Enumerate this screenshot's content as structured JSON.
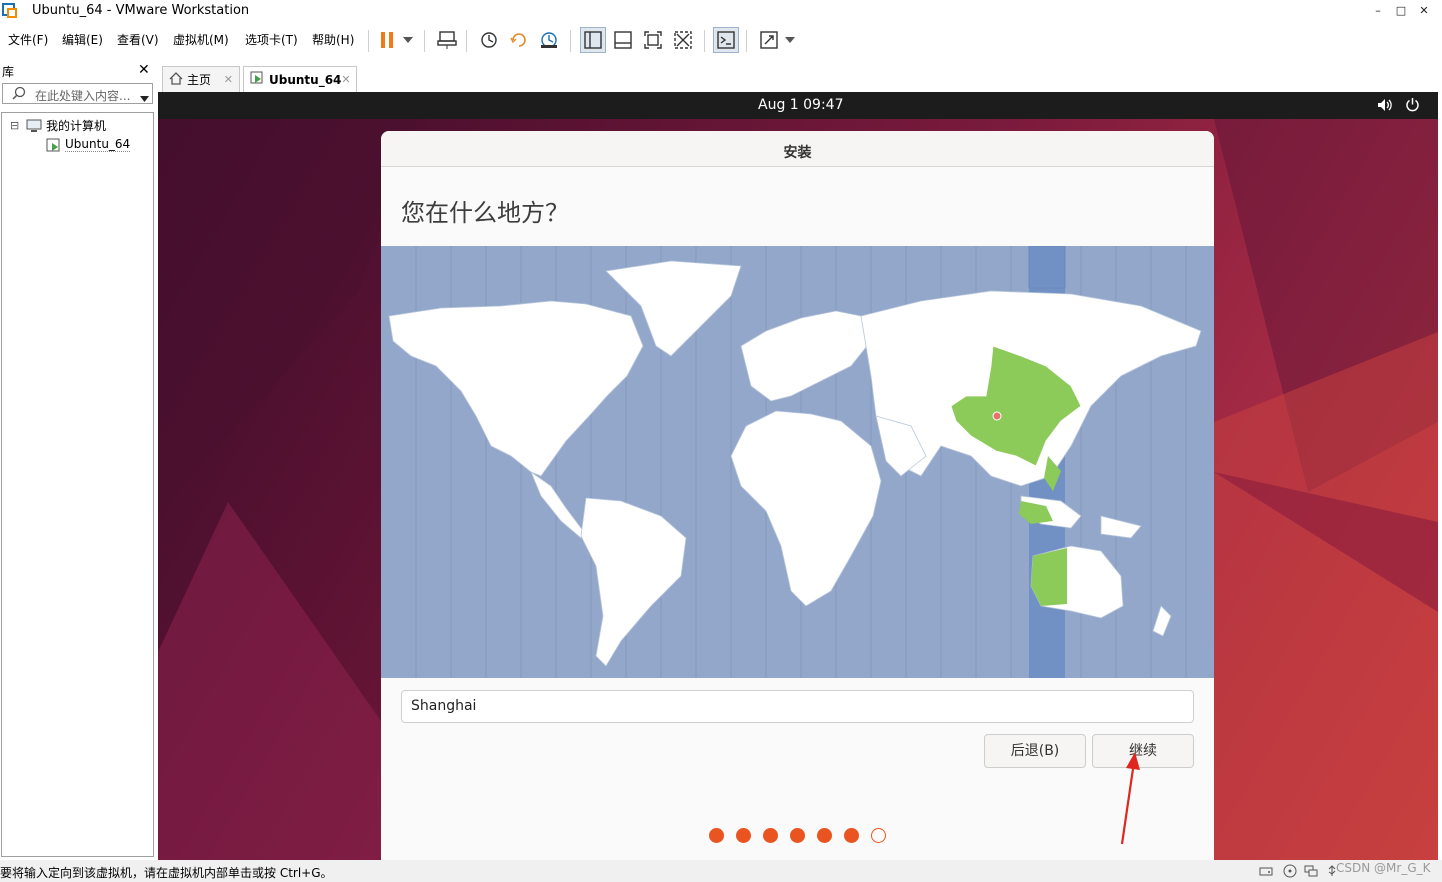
{
  "window": {
    "title": "Ubuntu_64 - VMware Workstation",
    "minimize": "–",
    "maximize": "□",
    "close": "✕"
  },
  "menu": [
    "文件(F)",
    "编辑(E)",
    "查看(V)",
    "虚拟机(M)",
    "选项卡(T)",
    "帮助(H)"
  ],
  "library": {
    "title": "库",
    "close": "✕",
    "search_placeholder": "在此处键入内容...",
    "tree": {
      "root": "我的计算机",
      "child": "Ubuntu_64",
      "expander": "⊟"
    }
  },
  "tabs": [
    {
      "label": "主页"
    },
    {
      "label": "Ubuntu_64"
    }
  ],
  "vm": {
    "clock": "Aug 1  09:47",
    "installer": {
      "title": "安装",
      "question": "您在什么地方？",
      "timezone_value": "Shanghai",
      "back_label": "后退(B)",
      "continue_label": "继续",
      "progress": {
        "total": 7,
        "done": 6
      }
    }
  },
  "status": {
    "text": "要将输入定向到该虚拟机，请在虚拟机内部单击或按 Ctrl+G。",
    "watermark": "CSDN @Mr_G_K"
  },
  "colors": {
    "ubuntu_orange": "#e95420",
    "map_ocean": "#92a7c9",
    "selected_region": "#8cca5a",
    "timezone_band": "#7191c4"
  }
}
